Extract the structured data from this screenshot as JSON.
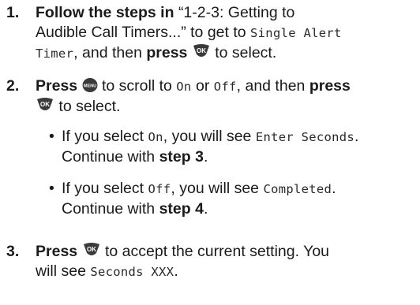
{
  "steps": [
    {
      "number": "1.",
      "bold_lead": "Follow the steps in",
      "ref": "“1-2-3: Getting to",
      "ref2": "Audible Call Timers...” to get to",
      "lcd_item": "Single Alert",
      "lcd_item2": "Timer",
      "mid": ", and then",
      "bold_action": "press",
      "tail": "to select.",
      "icon": "ok-key-icon"
    },
    {
      "number": "2.",
      "bold_lead": "Press",
      "icon1": "menu-key-icon",
      "mid": "to scroll to",
      "lcd_on": "On",
      "or_text": "or",
      "lcd_off": "Off",
      "then_text": ", and then",
      "bold_action": "press",
      "icon2": "ok-key-icon",
      "tail": "to select."
    },
    {
      "bullet_symbol": "•",
      "prefix": "If you select",
      "lcd_value": "On",
      "middle": ", you will see",
      "lcd_result": "Enter Seconds",
      "end": ".",
      "continue_text": "Continue with",
      "step_ref": "step 3",
      "period": "."
    },
    {
      "bullet_symbol": "•",
      "prefix": "If you select",
      "lcd_value": "Off",
      "middle": ", you will see",
      "lcd_result": "Completed",
      "end": ".",
      "continue_text": "Continue with",
      "step_ref": "step 4",
      "period": "."
    },
    {
      "number": "3.",
      "bold_lead": "Press",
      "icon": "ok-key-icon",
      "tail": "to accept the current setting. You",
      "line2": "will see",
      "lcd_result": "Seconds XXX",
      "period": "."
    }
  ]
}
